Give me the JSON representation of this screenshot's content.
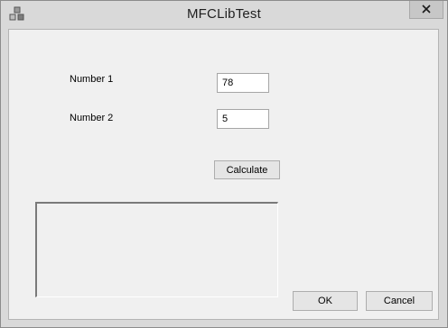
{
  "window": {
    "title": "MFCLibTest",
    "app_icon": "mfc-app-icon",
    "close_icon": "close-icon"
  },
  "form": {
    "number1_label": "Number 1",
    "number1_value": "78",
    "number2_label": "Number 2",
    "number2_value": "5",
    "calculate_label": "Calculate",
    "result_value": ""
  },
  "footer": {
    "ok_label": "OK",
    "cancel_label": "Cancel"
  }
}
